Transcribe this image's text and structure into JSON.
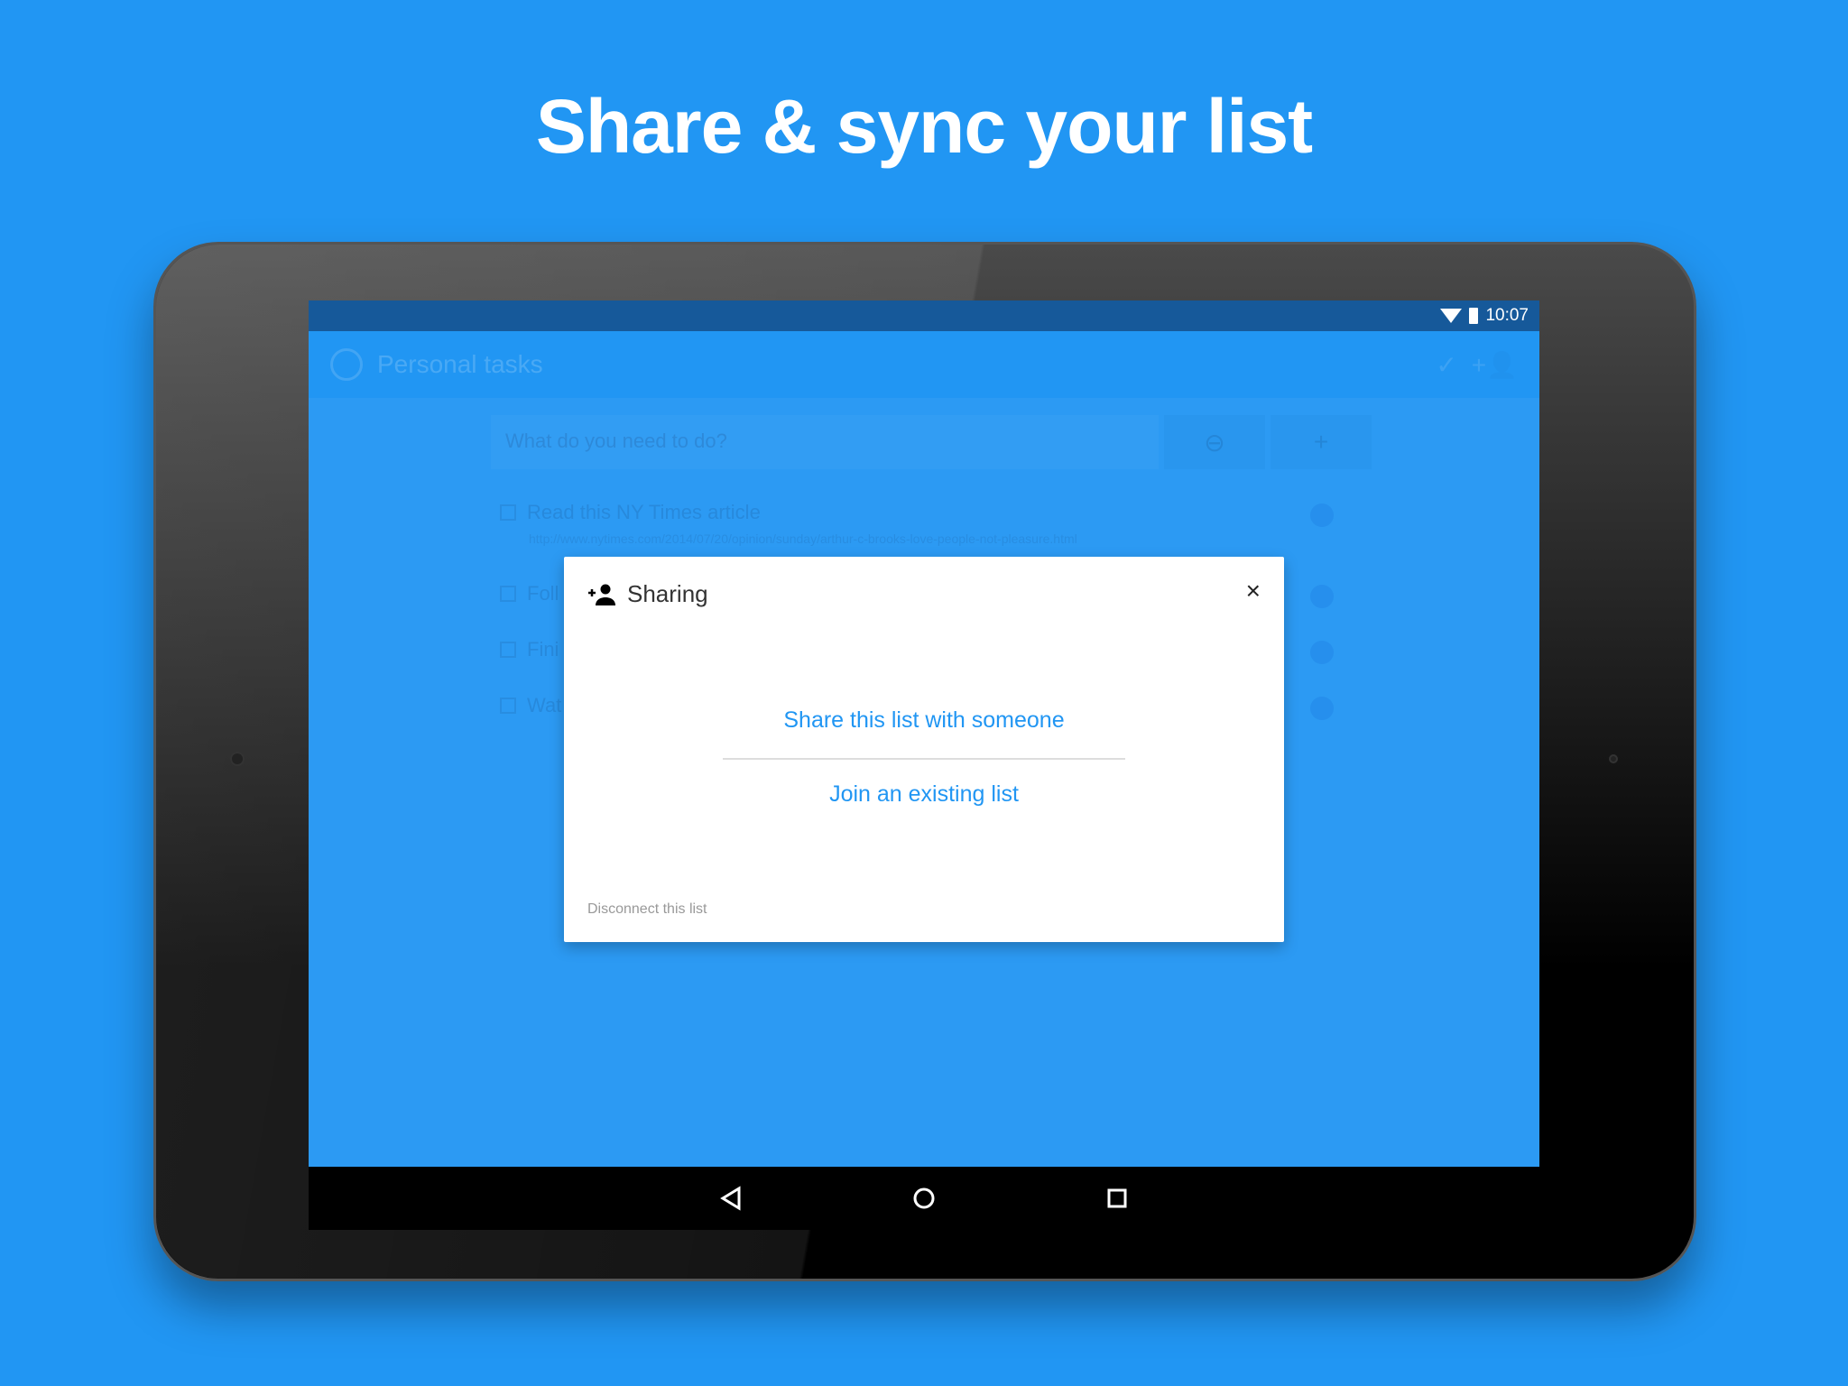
{
  "headline": "Share & sync your list",
  "status_bar": {
    "time": "10:07"
  },
  "app": {
    "title": "Personal tasks",
    "input_placeholder": "What do you need to do?",
    "tasks": [
      {
        "title": "Read this NY Times article",
        "url": "http://www.nytimes.com/2014/07/20/opinion/sunday/arthur-c-brooks-love-people-not-pleasure.html"
      },
      {
        "title": "Foll"
      },
      {
        "title": "Fini"
      },
      {
        "title": "Wat"
      }
    ]
  },
  "dialog": {
    "title": "Sharing",
    "share_label": "Share this list with someone",
    "join_label": "Join an existing list",
    "disconnect_label": "Disconnect this list",
    "close_label": "×"
  },
  "colors": {
    "background": "#2196F3",
    "accent": "#2196F3"
  }
}
